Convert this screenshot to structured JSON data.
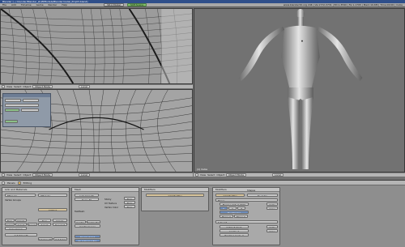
{
  "window": {
    "title": "Blender [~/.blender/Blender_stuff/Models/Blendermodel_Proj03.blend]",
    "stats": "www.blender3d.org 246 | Ve:1772-3731 | Ed:1-3590 | Fa:1-1795 | Mem:19.6M | Time:00:00 | Cube"
  },
  "menubar": {
    "items": [
      "File",
      "Add",
      "Timeline",
      "Game",
      "Render",
      "Help"
    ],
    "screen": "SR:2-Model",
    "scene": "SCE:Scene"
  },
  "viewports": {
    "top_left": {
      "header": [
        "View",
        "Select",
        "Object",
        "Object Mode",
        "Local"
      ]
    },
    "mid_left": {
      "header": [
        "View",
        "Select",
        "Object",
        "Object Mode",
        "Local"
      ]
    },
    "right": {
      "header": [
        "View",
        "Select",
        "Object",
        "Object Mode",
        "Local"
      ],
      "label": "(1) Cube"
    },
    "bottom_left": {
      "header": [
        "View",
        "Select",
        "Object",
        "Object Mode"
      ]
    }
  },
  "props": {
    "header": [
      "Panels",
      "Editing"
    ],
    "link_panel": {
      "title": "Link and Materials",
      "me": "ME:Cube",
      "ob": "OB:Cube",
      "vertex_groups": "Vertex Groups",
      "material": "0 Mat 0",
      "buttons": [
        "New",
        "Delete",
        "New",
        "Delete",
        "Assign",
        "Select",
        "Deselect",
        "Copy Group",
        "Select",
        "Deselect"
      ],
      "set_smooth": "Set Smooth",
      "set_solid": "Set Solid",
      "auto_smooth": "AutoSmooth"
    },
    "mesh_panel": {
      "title": "Mesh",
      "auto_smooth": "Auto Smooth",
      "degr": "Degr: 30",
      "sticky": "Sticky",
      "uv_texture": "UV Texture",
      "vertex_color": "Vertex Color",
      "new": "New",
      "texmesh": "TexMesh:",
      "center": "Center",
      "center_new": "Center New",
      "center_cursor": "Center Cursor",
      "double_sided": "Double Sided",
      "no_vnormal_flip": "No V.Normal Flip"
    },
    "modifiers_panel": {
      "title": "Modifiers",
      "add_modifier": "Add Modifier",
      "tab": "Shapes",
      "to_cube": "To: Cube"
    },
    "modifier_stack": {
      "header": "Modifiers",
      "mirror": "Mirror",
      "merge_limit": "Merge Limit: 0.0010",
      "axes": [
        "X",
        "Y",
        "Z"
      ],
      "do_clipping": "Do Clipping",
      "mirror_u": "Mirror U",
      "mirror_v": "Mirror V",
      "apply": "Apply",
      "copy": "Copy",
      "subsurf": "Subsurf",
      "catmull": "Catmull-Clark",
      "levels": "Levels: 1",
      "render_levels": "Render Levels: 2",
      "apply2": "Apply",
      "copy2": "Copy"
    }
  }
}
